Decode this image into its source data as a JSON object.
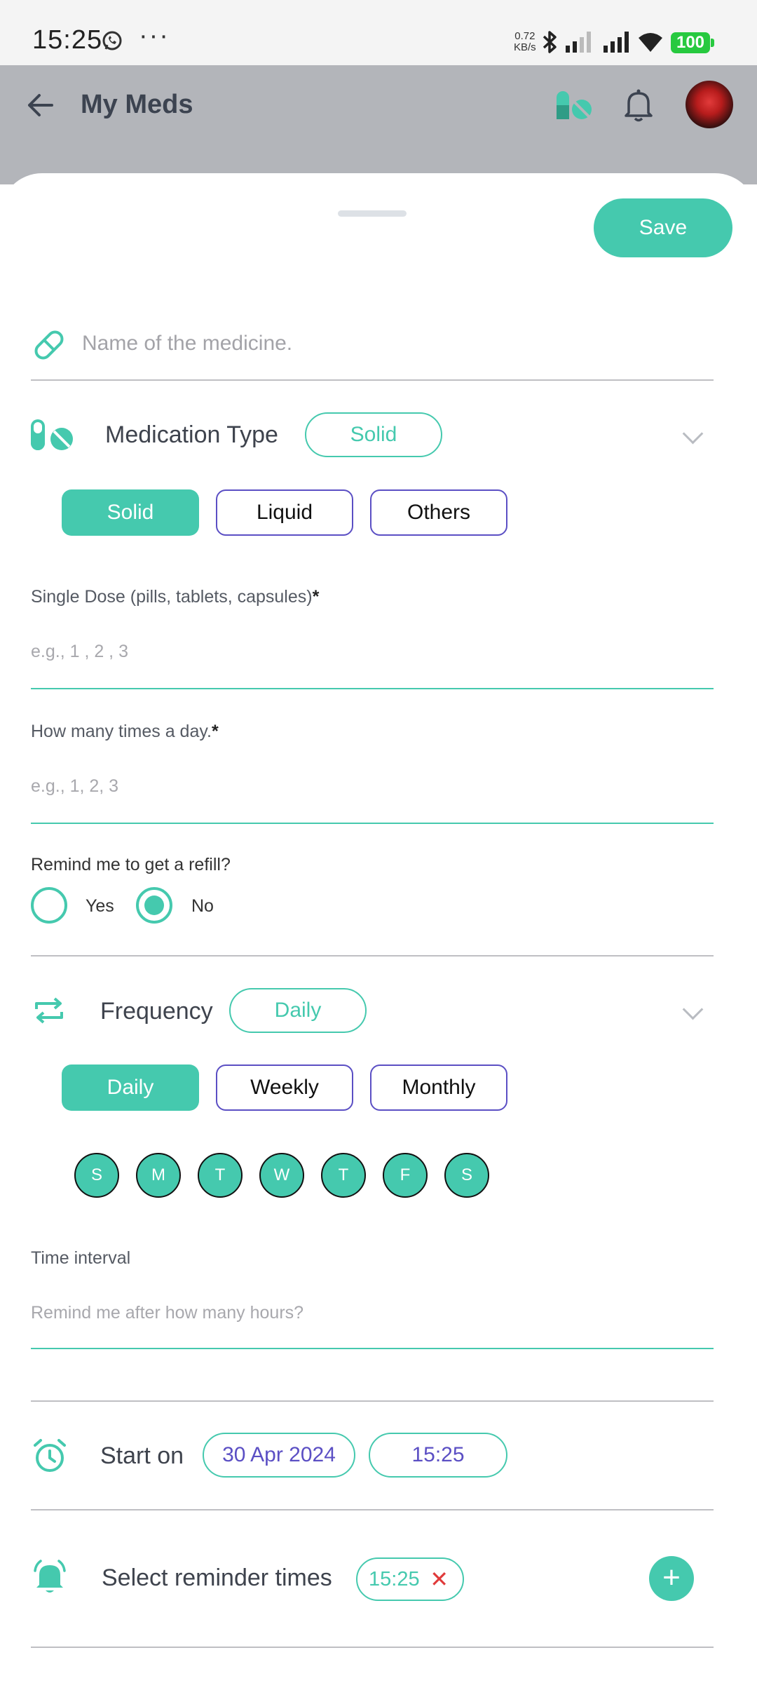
{
  "status_bar": {
    "time": "15:25",
    "more": "···",
    "net_speed_value": "0.72",
    "net_speed_unit": "KB/s",
    "battery": "100"
  },
  "app_bar": {
    "title": "My Meds"
  },
  "sheet": {
    "save_label": "Save",
    "medicine_name_placeholder": "Name of the medicine.",
    "medication_type": {
      "label": "Medication Type",
      "selected": "Solid",
      "options": [
        "Solid",
        "Liquid",
        "Others"
      ]
    },
    "single_dose": {
      "label": "Single Dose (pills, tablets, capsules)",
      "required_mark": "*",
      "placeholder": "e.g., 1 , 2 , 3"
    },
    "times_a_day": {
      "label": "How many times a day.",
      "required_mark": "*",
      "placeholder": "e.g., 1, 2, 3"
    },
    "refill": {
      "question": "Remind me to get a refill?",
      "yes_label": "Yes",
      "no_label": "No",
      "selected": "No"
    },
    "frequency": {
      "label": "Frequency",
      "selected": "Daily",
      "options": [
        "Daily",
        "Weekly",
        "Monthly"
      ],
      "days": [
        "S",
        "M",
        "T",
        "W",
        "T",
        "F",
        "S"
      ]
    },
    "time_interval": {
      "label": "Time interval",
      "placeholder": "Remind me after how many hours?"
    },
    "start_on": {
      "label": "Start on",
      "date": "30 Apr 2024",
      "time": "15:25"
    },
    "reminder": {
      "label": "Select reminder times",
      "times": [
        "15:25"
      ],
      "remove_glyph": "✕",
      "add_glyph": "+"
    }
  },
  "colors": {
    "accent": "#45c9ae",
    "segment_border": "#5b4fc4",
    "start_text": "#5b4fc4",
    "remove": "#e03a3a",
    "battery": "#27c93f"
  }
}
